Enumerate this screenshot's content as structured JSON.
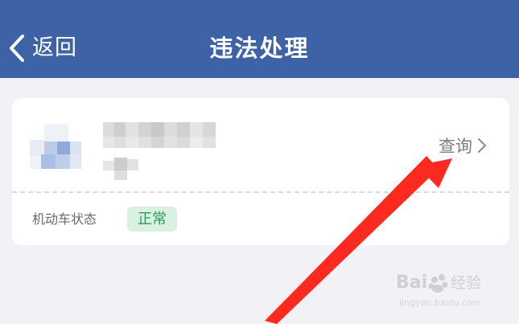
{
  "header": {
    "back_label": "返回",
    "title": "违法处理",
    "background_color": "#3d62a6"
  },
  "card": {
    "query_label": "查询",
    "status_label": "机动车状态",
    "status_value": "正常",
    "status_color": "#2e9a5a",
    "icons": [
      "chevron-left-icon",
      "chevron-right-icon"
    ]
  }
}
